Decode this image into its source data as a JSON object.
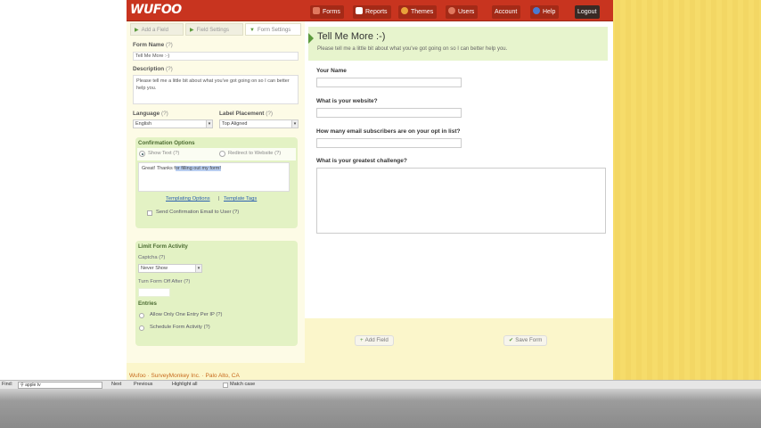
{
  "app": {
    "logo": "WUFOO",
    "nav": [
      {
        "label": "Forms",
        "icon": "forms-icon"
      },
      {
        "label": "Reports",
        "icon": "reports-icon"
      },
      {
        "label": "Themes",
        "icon": "themes-icon"
      },
      {
        "label": "Users",
        "icon": "users-icon"
      },
      {
        "label": "Account"
      },
      {
        "label": "Help",
        "icon": "help-icon"
      },
      {
        "label": "Logout"
      }
    ]
  },
  "tabs": [
    "Add a Field",
    "Field Settings",
    "Form Settings"
  ],
  "settings": {
    "form_name_label": "Form Name",
    "form_name_value": "Tell Me More :-)",
    "description_label": "Description",
    "description_value": "Please tell me a little bit about what you've got going on so I can better help you.",
    "language_label": "Language",
    "language_value": "English",
    "label_placement_label": "Label Placement",
    "label_placement_value": "Top Aligned",
    "q": "(?)"
  },
  "confirmation": {
    "title": "Confirmation Options",
    "show_text": "Show Text",
    "redirect": "Redirect to Website",
    "message_prefix": "Great! Thanks f",
    "message_selected": "or filling out my form!",
    "templating_link": "Templating Options",
    "separator": "|",
    "template_tags_link": "Template Tags",
    "send_email": "Send Confirmation Email to User"
  },
  "limit": {
    "title": "Limit Form Activity",
    "captcha_label": "Captcha",
    "captcha_value": "Never Show",
    "turn_off_label": "Turn Form Off After",
    "entries_label": "Entries",
    "one_entry": "Allow Only One Entry Per IP",
    "schedule": "Schedule Form Activity"
  },
  "form": {
    "title": "Tell Me More :-)",
    "description": "Please tell me a little bit about what you've got going on so I can better help you.",
    "fields": [
      "Your Name",
      "What is your website?",
      "How many email subscribers are on your opt in list?",
      "What is your greatest challenge?"
    ]
  },
  "buttons": {
    "add_field": "Add Field",
    "save_form": "Save Form"
  },
  "footer": {
    "text": "Wufoo · SurveyMonkey Inc. · Palo Alto, CA"
  },
  "findbar": {
    "label": "Find:",
    "query": "apple tv",
    "next": "Next",
    "previous": "Previous",
    "highlight": "Highlight all",
    "match_case": "Match case"
  },
  "colors": {
    "brand_red": "#c8341f",
    "green_panel": "#e3f2c4",
    "accent_green": "#5b9a3c"
  }
}
